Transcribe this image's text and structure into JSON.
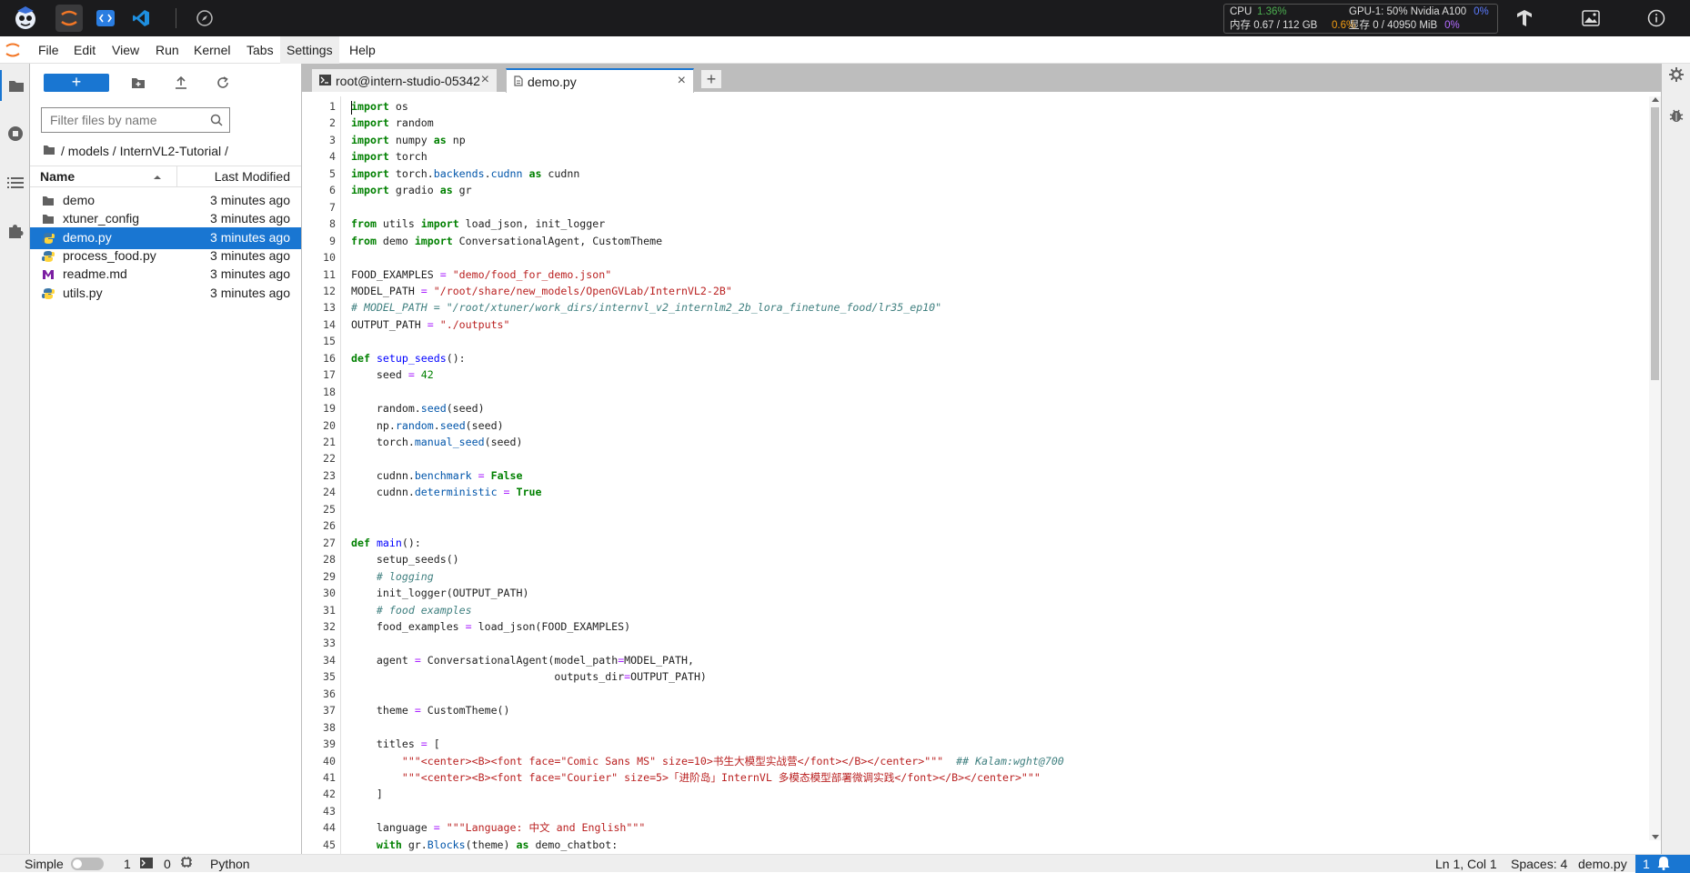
{
  "top_bar": {
    "icons": [
      "intern-logo-icon",
      "jupyter-icon",
      "code-icon",
      "vscode-icon",
      "compass-icon",
      "tensorflow-icon",
      "image-icon",
      "info-icon"
    ],
    "stats": {
      "cpu_label": "CPU",
      "cpu_value": "1.36%",
      "gpu_label": "GPU-1: 50% Nvidia A100",
      "gpu_value": "0%",
      "mem_label": "内存 0.67 / 112 GB",
      "mem_value": "0.6%",
      "vram_label": "显存 0 / 40950 MiB",
      "vram_value": "0%"
    }
  },
  "menu": [
    "File",
    "Edit",
    "View",
    "Run",
    "Kernel",
    "Tabs",
    "Settings",
    "Help"
  ],
  "file_browser": {
    "new_label": "+",
    "search_placeholder": "Filter files by name",
    "breadcrumb": "/ models / InternVL2-Tutorial /",
    "col_name": "Name",
    "col_modified": "Last Modified",
    "files": [
      {
        "name": "demo",
        "type": "folder",
        "modified": "3 minutes ago"
      },
      {
        "name": "xtuner_config",
        "type": "folder",
        "modified": "3 minutes ago"
      },
      {
        "name": "demo.py",
        "type": "python",
        "modified": "3 minutes ago",
        "selected": true
      },
      {
        "name": "process_food.py",
        "type": "python",
        "modified": "3 minutes ago"
      },
      {
        "name": "readme.md",
        "type": "markdown",
        "modified": "3 minutes ago"
      },
      {
        "name": "utils.py",
        "type": "python",
        "modified": "3 minutes ago"
      }
    ]
  },
  "tabs": [
    {
      "label": "root@intern-studio-05342",
      "close": "×"
    },
    {
      "label": "demo.py",
      "close": "×",
      "active": true
    }
  ],
  "add_tab": "+",
  "code_lines": [
    "import os",
    "import random",
    "import numpy as np",
    "import torch",
    "import torch.backends.cudnn as cudnn",
    "import gradio as gr",
    "",
    "from utils import load_json, init_logger",
    "from demo import ConversationalAgent, CustomTheme",
    "",
    "FOOD_EXAMPLES = \"demo/food_for_demo.json\"",
    "MODEL_PATH = \"/root/share/new_models/OpenGVLab/InternVL2-2B\"",
    "# MODEL_PATH = \"/root/xtuner/work_dirs/internvl_v2_internlm2_2b_lora_finetune_food/lr35_ep10\"",
    "OUTPUT_PATH = \"./outputs\"",
    "",
    "def setup_seeds():",
    "    seed = 42",
    "",
    "    random.seed(seed)",
    "    np.random.seed(seed)",
    "    torch.manual_seed(seed)",
    "",
    "    cudnn.benchmark = False",
    "    cudnn.deterministic = True",
    "",
    "",
    "def main():",
    "    setup_seeds()",
    "    # logging",
    "    init_logger(OUTPUT_PATH)",
    "    # food examples",
    "    food_examples = load_json(FOOD_EXAMPLES)",
    "",
    "    agent = ConversationalAgent(model_path=MODEL_PATH,",
    "                                outputs_dir=OUTPUT_PATH)",
    "",
    "    theme = CustomTheme()",
    "",
    "    titles = [",
    "        \"\"\"<center><B><font face=\"Comic Sans MS\" size=10>书生大模型实战营</font></B></center>\"\"\"  ## Kalam:wght@700",
    "        \"\"\"<center><B><font face=\"Courier\" size=5>「进阶岛」InternVL 多模态模型部署微调实践</font></B></center>\"\"\"",
    "    ]",
    "",
    "    language = \"\"\"Language: 中文 and English\"\"\"",
    "    with gr.Blocks(theme) as demo_chatbot:"
  ],
  "status_bar": {
    "mode": "Simple",
    "terminals": "1",
    "kernels": "0",
    "language": "Python",
    "cursor": "Ln 1, Col 1",
    "spaces": "Spaces: 4",
    "file": "demo.py",
    "notifications": "1"
  }
}
